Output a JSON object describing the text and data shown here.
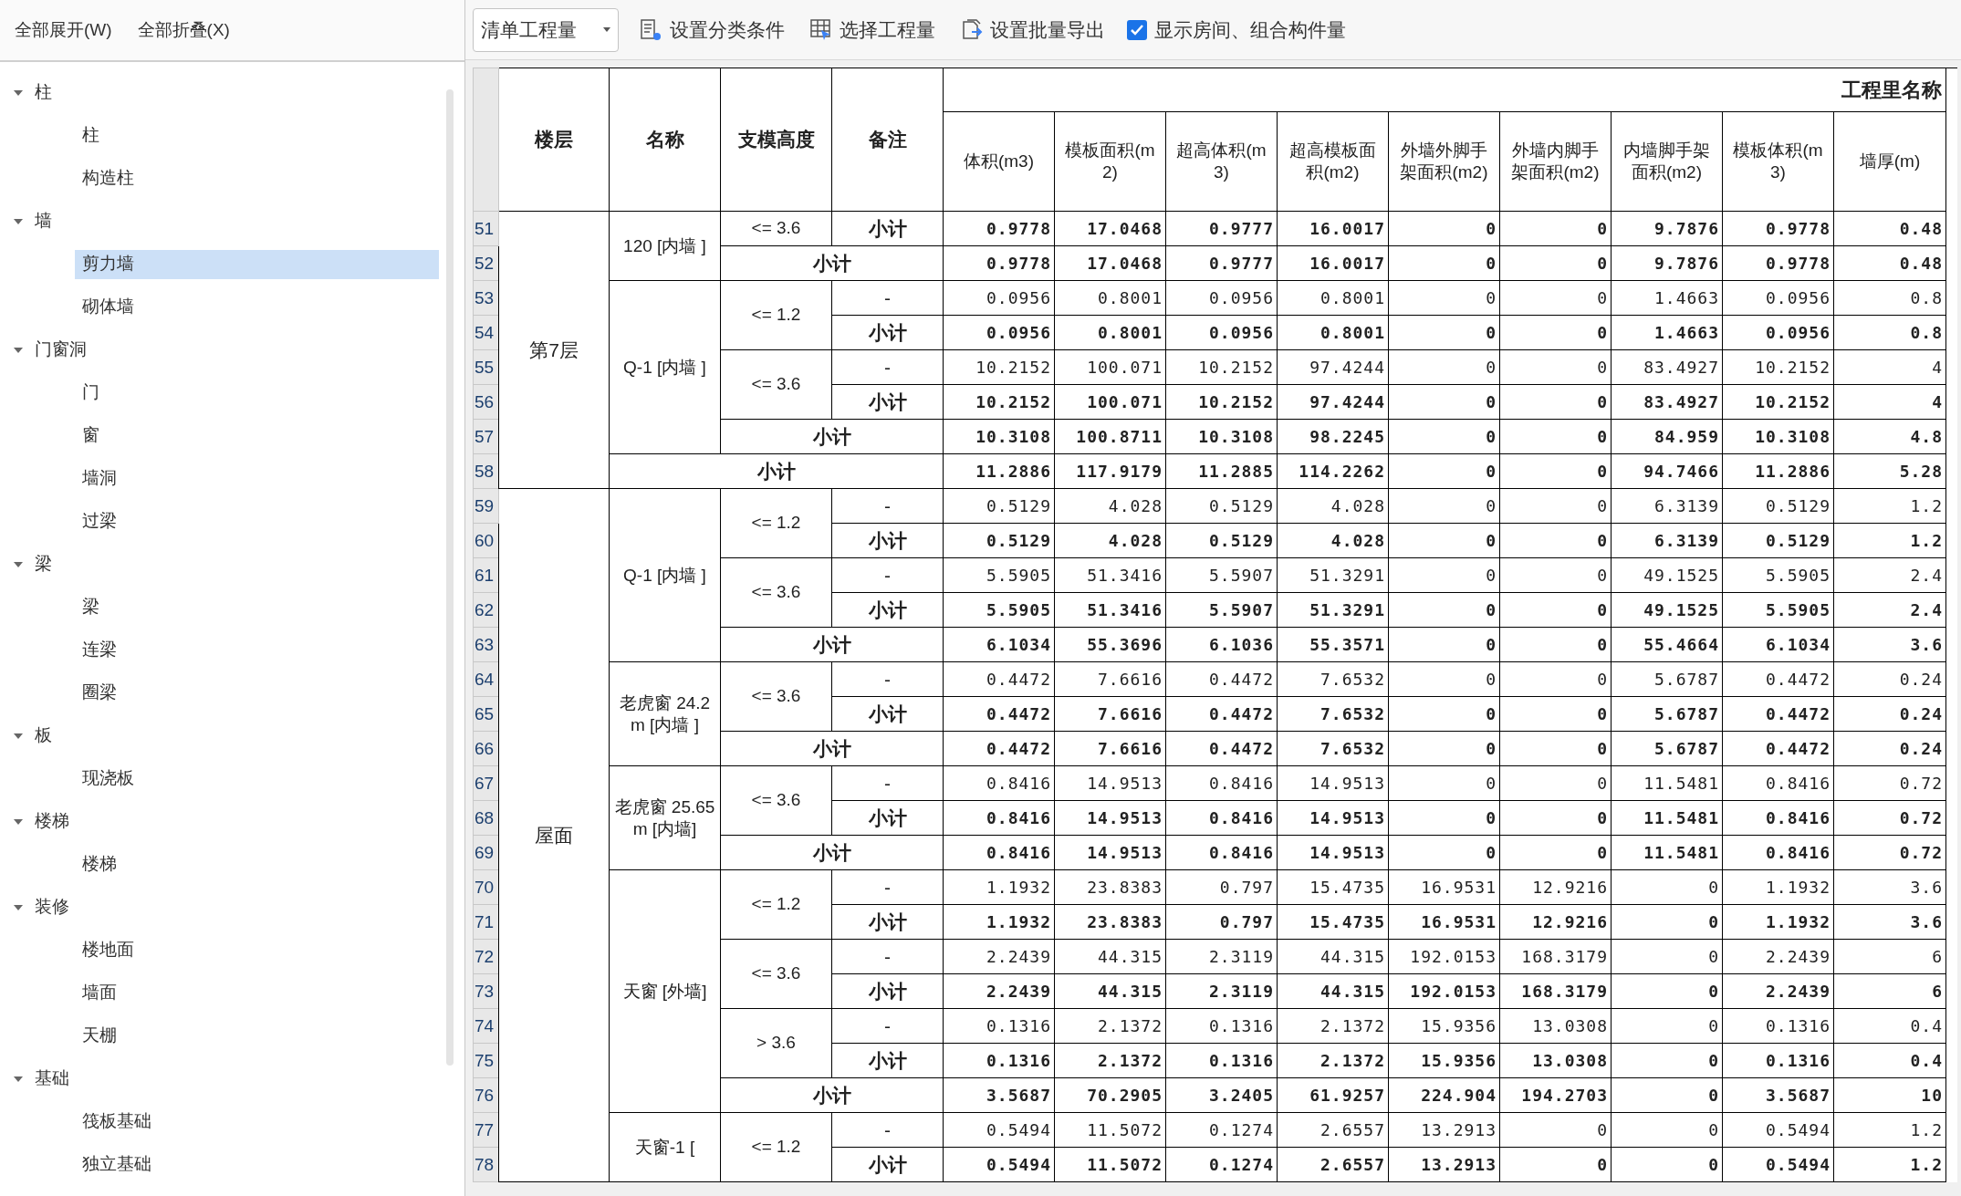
{
  "sidebar": {
    "buttons": [
      "全部展开(W)",
      "全部折叠(X)"
    ],
    "tree": [
      {
        "label": "柱",
        "expanded": true,
        "children": [
          {
            "label": "柱",
            "selected": false
          },
          {
            "label": "构造柱",
            "selected": false
          }
        ]
      },
      {
        "label": "墙",
        "expanded": true,
        "children": [
          {
            "label": "剪力墙",
            "selected": true
          },
          {
            "label": "砌体墙",
            "selected": false
          }
        ]
      },
      {
        "label": "门窗洞",
        "expanded": true,
        "children": [
          {
            "label": "门",
            "selected": false
          },
          {
            "label": "窗",
            "selected": false
          },
          {
            "label": "墙洞",
            "selected": false
          },
          {
            "label": "过梁",
            "selected": false
          }
        ]
      },
      {
        "label": "梁",
        "expanded": true,
        "children": [
          {
            "label": "梁",
            "selected": false
          },
          {
            "label": "连梁",
            "selected": false
          },
          {
            "label": "圈梁",
            "selected": false
          }
        ]
      },
      {
        "label": "板",
        "expanded": true,
        "children": [
          {
            "label": "现浇板",
            "selected": false
          }
        ]
      },
      {
        "label": "楼梯",
        "expanded": true,
        "children": [
          {
            "label": "楼梯",
            "selected": false
          }
        ]
      },
      {
        "label": "装修",
        "expanded": true,
        "children": [
          {
            "label": "楼地面",
            "selected": false
          },
          {
            "label": "墙面",
            "selected": false
          },
          {
            "label": "天棚",
            "selected": false
          }
        ]
      },
      {
        "label": "基础",
        "expanded": true,
        "children": [
          {
            "label": "筏板基础",
            "selected": false
          },
          {
            "label": "独立基础",
            "selected": false
          }
        ]
      }
    ]
  },
  "toolbar": {
    "dropdown": "清单工程量",
    "buttons": [
      {
        "kind": "filter",
        "label": "设置分类条件"
      },
      {
        "kind": "grid",
        "label": "选择工程量"
      },
      {
        "kind": "export",
        "label": "设置批量导出"
      }
    ],
    "checkbox": {
      "label": "显示房间、组合构件量",
      "checked": true
    }
  },
  "table": {
    "columns": [
      "楼层",
      "名称",
      "支模高度",
      "备注"
    ],
    "group_header": "工程里名称",
    "value_columns": [
      "体积(m3)",
      "模板面积(m2)",
      "超高体积(m3)",
      "超高模板面积(m2)",
      "外墙外脚手架面积(m2)",
      "外墙内脚手架面积(m2)",
      "内墙脚手架面积(m2)",
      "模板体积(m3)",
      "墙厚(m)"
    ],
    "floors": [
      {
        "floor": "第7层",
        "groups": [
          {
            "name": "120 [内墙 ]",
            "heights": [
              {
                "height": "<= 3.6",
                "rows": [
                  {
                    "number": "51",
                    "remark": "小计",
                    "kind": "subtotal",
                    "values": [
                      "0.9778",
                      "17.0468",
                      "0.9777",
                      "16.0017",
                      "0",
                      "0",
                      "9.7876",
                      "0.9778",
                      "0.48"
                    ]
                  }
                ]
              }
            ],
            "subtotal": {
              "number": "52",
              "label": "小计",
              "values": [
                "0.9778",
                "17.0468",
                "0.9777",
                "16.0017",
                "0",
                "0",
                "9.7876",
                "0.9778",
                "0.48"
              ]
            }
          },
          {
            "name": "Q-1 [内墙 ]",
            "heights": [
              {
                "height": "<= 1.2",
                "rows": [
                  {
                    "number": "53",
                    "remark": "-",
                    "kind": "detail",
                    "values": [
                      "0.0956",
                      "0.8001",
                      "0.0956",
                      "0.8001",
                      "0",
                      "0",
                      "1.4663",
                      "0.0956",
                      "0.8"
                    ]
                  },
                  {
                    "number": "54",
                    "remark": "小计",
                    "kind": "subtotal",
                    "values": [
                      "0.0956",
                      "0.8001",
                      "0.0956",
                      "0.8001",
                      "0",
                      "0",
                      "1.4663",
                      "0.0956",
                      "0.8"
                    ]
                  }
                ]
              },
              {
                "height": "<= 3.6",
                "rows": [
                  {
                    "number": "55",
                    "remark": "-",
                    "kind": "detail",
                    "values": [
                      "10.2152",
                      "100.071",
                      "10.2152",
                      "97.4244",
                      "0",
                      "0",
                      "83.4927",
                      "10.2152",
                      "4"
                    ]
                  },
                  {
                    "number": "56",
                    "remark": "小计",
                    "kind": "subtotal",
                    "values": [
                      "10.2152",
                      "100.071",
                      "10.2152",
                      "97.4244",
                      "0",
                      "0",
                      "83.4927",
                      "10.2152",
                      "4"
                    ]
                  }
                ]
              }
            ],
            "subtotal": {
              "number": "57",
              "label": "小计",
              "values": [
                "10.3108",
                "100.8711",
                "10.3108",
                "98.2245",
                "0",
                "0",
                "84.959",
                "10.3108",
                "4.8"
              ]
            }
          }
        ],
        "subtotal": {
          "number": "58",
          "label": "小计",
          "values": [
            "11.2886",
            "117.9179",
            "11.2885",
            "114.2262",
            "0",
            "0",
            "94.7466",
            "11.2886",
            "5.28"
          ]
        }
      },
      {
        "floor": "屋面",
        "groups": [
          {
            "name": "Q-1 [内墙 ]",
            "heights": [
              {
                "height": "<= 1.2",
                "rows": [
                  {
                    "number": "59",
                    "remark": "-",
                    "kind": "detail",
                    "values": [
                      "0.5129",
                      "4.028",
                      "0.5129",
                      "4.028",
                      "0",
                      "0",
                      "6.3139",
                      "0.5129",
                      "1.2"
                    ]
                  },
                  {
                    "number": "60",
                    "remark": "小计",
                    "kind": "subtotal",
                    "values": [
                      "0.5129",
                      "4.028",
                      "0.5129",
                      "4.028",
                      "0",
                      "0",
                      "6.3139",
                      "0.5129",
                      "1.2"
                    ]
                  }
                ]
              },
              {
                "height": "<= 3.6",
                "rows": [
                  {
                    "number": "61",
                    "remark": "-",
                    "kind": "detail",
                    "values": [
                      "5.5905",
                      "51.3416",
                      "5.5907",
                      "51.3291",
                      "0",
                      "0",
                      "49.1525",
                      "5.5905",
                      "2.4"
                    ]
                  },
                  {
                    "number": "62",
                    "remark": "小计",
                    "kind": "subtotal",
                    "values": [
                      "5.5905",
                      "51.3416",
                      "5.5907",
                      "51.3291",
                      "0",
                      "0",
                      "49.1525",
                      "5.5905",
                      "2.4"
                    ]
                  }
                ]
              }
            ],
            "subtotal": {
              "number": "63",
              "label": "小计",
              "values": [
                "6.1034",
                "55.3696",
                "6.1036",
                "55.3571",
                "0",
                "0",
                "55.4664",
                "6.1034",
                "3.6"
              ]
            }
          },
          {
            "name": "老虎窗 24.2m [内墙 ]",
            "heights": [
              {
                "height": "<= 3.6",
                "rows": [
                  {
                    "number": "64",
                    "remark": "-",
                    "kind": "detail",
                    "values": [
                      "0.4472",
                      "7.6616",
                      "0.4472",
                      "7.6532",
                      "0",
                      "0",
                      "5.6787",
                      "0.4472",
                      "0.24"
                    ]
                  },
                  {
                    "number": "65",
                    "remark": "小计",
                    "kind": "subtotal",
                    "values": [
                      "0.4472",
                      "7.6616",
                      "0.4472",
                      "7.6532",
                      "0",
                      "0",
                      "5.6787",
                      "0.4472",
                      "0.24"
                    ]
                  }
                ]
              }
            ],
            "subtotal": {
              "number": "66",
              "label": "小计",
              "values": [
                "0.4472",
                "7.6616",
                "0.4472",
                "7.6532",
                "0",
                "0",
                "5.6787",
                "0.4472",
                "0.24"
              ]
            }
          },
          {
            "name": "老虎窗 25.65m [内墙]",
            "heights": [
              {
                "height": "<= 3.6",
                "rows": [
                  {
                    "number": "67",
                    "remark": "-",
                    "kind": "detail",
                    "values": [
                      "0.8416",
                      "14.9513",
                      "0.8416",
                      "14.9513",
                      "0",
                      "0",
                      "11.5481",
                      "0.8416",
                      "0.72"
                    ]
                  },
                  {
                    "number": "68",
                    "remark": "小计",
                    "kind": "subtotal",
                    "values": [
                      "0.8416",
                      "14.9513",
                      "0.8416",
                      "14.9513",
                      "0",
                      "0",
                      "11.5481",
                      "0.8416",
                      "0.72"
                    ]
                  }
                ]
              }
            ],
            "subtotal": {
              "number": "69",
              "label": "小计",
              "values": [
                "0.8416",
                "14.9513",
                "0.8416",
                "14.9513",
                "0",
                "0",
                "11.5481",
                "0.8416",
                "0.72"
              ]
            }
          },
          {
            "name": "天窗 [外墙]",
            "heights": [
              {
                "height": "<= 1.2",
                "rows": [
                  {
                    "number": "70",
                    "remark": "-",
                    "kind": "detail",
                    "values": [
                      "1.1932",
                      "23.8383",
                      "0.797",
                      "15.4735",
                      "16.9531",
                      "12.9216",
                      "0",
                      "1.1932",
                      "3.6"
                    ]
                  },
                  {
                    "number": "71",
                    "remark": "小计",
                    "kind": "subtotal",
                    "values": [
                      "1.1932",
                      "23.8383",
                      "0.797",
                      "15.4735",
                      "16.9531",
                      "12.9216",
                      "0",
                      "1.1932",
                      "3.6"
                    ]
                  }
                ]
              },
              {
                "height": "<= 3.6",
                "rows": [
                  {
                    "number": "72",
                    "remark": "-",
                    "kind": "detail",
                    "values": [
                      "2.2439",
                      "44.315",
                      "2.3119",
                      "44.315",
                      "192.0153",
                      "168.3179",
                      "0",
                      "2.2439",
                      "6"
                    ]
                  },
                  {
                    "number": "73",
                    "remark": "小计",
                    "kind": "subtotal",
                    "values": [
                      "2.2439",
                      "44.315",
                      "2.3119",
                      "44.315",
                      "192.0153",
                      "168.3179",
                      "0",
                      "2.2439",
                      "6"
                    ]
                  }
                ]
              },
              {
                "height": "> 3.6",
                "rows": [
                  {
                    "number": "74",
                    "remark": "-",
                    "kind": "detail",
                    "values": [
                      "0.1316",
                      "2.1372",
                      "0.1316",
                      "2.1372",
                      "15.9356",
                      "13.0308",
                      "0",
                      "0.1316",
                      "0.4"
                    ]
                  },
                  {
                    "number": "75",
                    "remark": "小计",
                    "kind": "subtotal",
                    "values": [
                      "0.1316",
                      "2.1372",
                      "0.1316",
                      "2.1372",
                      "15.9356",
                      "13.0308",
                      "0",
                      "0.1316",
                      "0.4"
                    ]
                  }
                ]
              }
            ],
            "subtotal": {
              "number": "76",
              "label": "小计",
              "values": [
                "3.5687",
                "70.2905",
                "3.2405",
                "61.9257",
                "224.904",
                "194.2703",
                "0",
                "3.5687",
                "10"
              ]
            }
          },
          {
            "name": "天窗-1 [",
            "heights": [
              {
                "height": "<= 1.2",
                "rows": [
                  {
                    "number": "77",
                    "remark": "-",
                    "kind": "detail",
                    "values": [
                      "0.5494",
                      "11.5072",
                      "0.1274",
                      "2.6557",
                      "13.2913",
                      "0",
                      "0",
                      "0.5494",
                      "1.2"
                    ]
                  },
                  {
                    "number": "78",
                    "remark": "小计",
                    "kind": "subtotal",
                    "values": [
                      "0.5494",
                      "11.5072",
                      "0.1274",
                      "2.6557",
                      "13.2913",
                      "0",
                      "0",
                      "0.5494",
                      "1.2"
                    ]
                  }
                ]
              }
            ]
          }
        ]
      }
    ]
  }
}
